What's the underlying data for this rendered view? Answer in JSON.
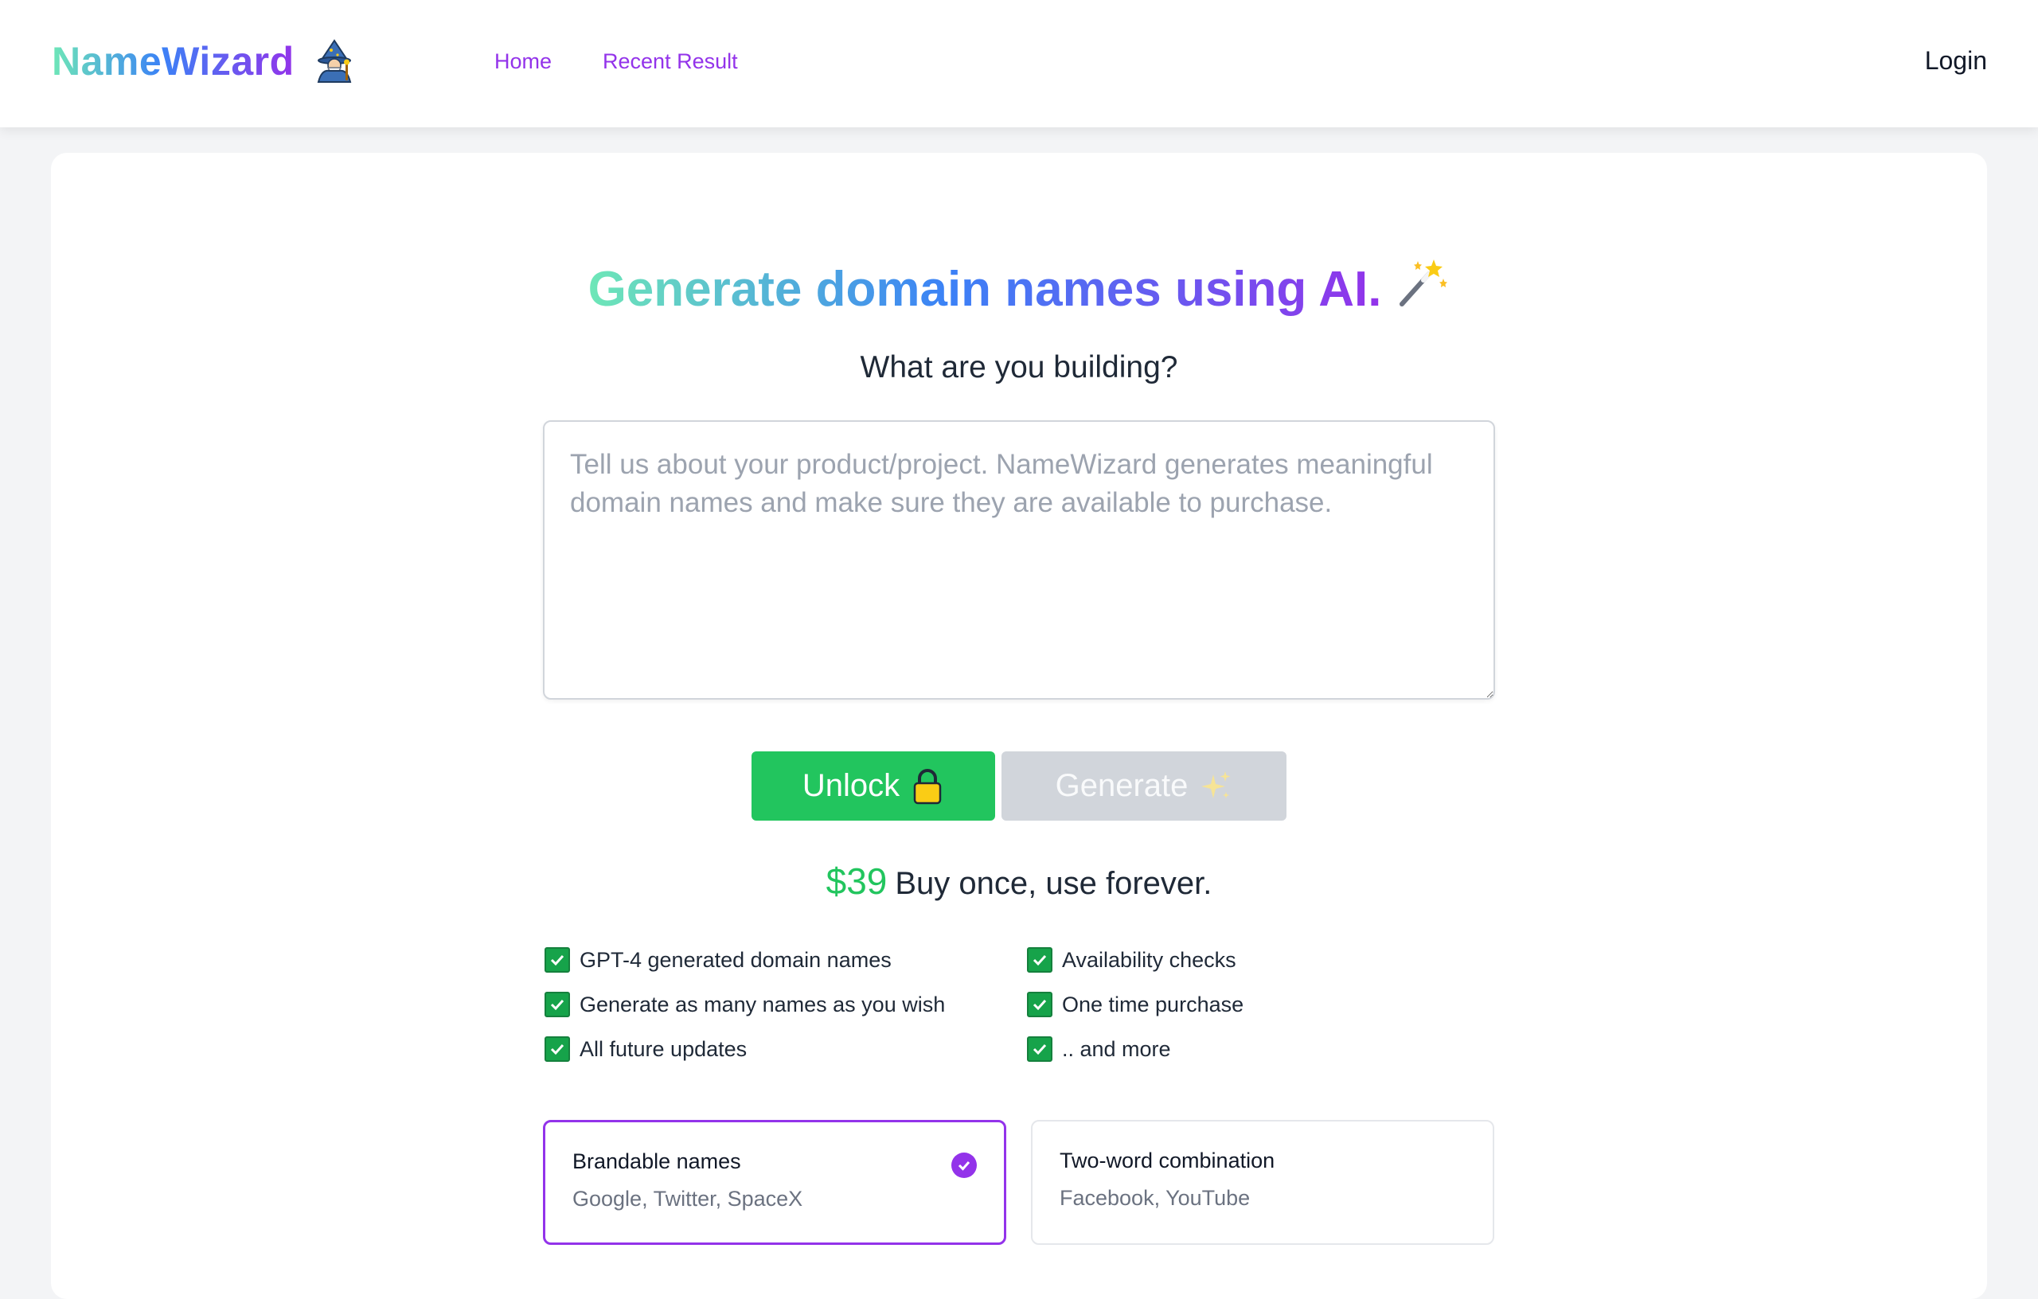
{
  "brand": {
    "name": "NameWizard",
    "icon": "wizard-icon"
  },
  "nav": {
    "links": [
      {
        "label": "Home"
      },
      {
        "label": "Recent Result"
      }
    ],
    "login_label": "Login"
  },
  "hero": {
    "headline": "Generate domain names using AI.",
    "headline_icon": "magic-wand-icon",
    "subheadline": "What are you building?"
  },
  "input": {
    "value": "",
    "placeholder": "Tell us about your product/project. NameWizard generates meaningful domain names and make sure they are available to purchase."
  },
  "actions": {
    "unlock_label": "Unlock",
    "unlock_icon": "lock-icon",
    "generate_label": "Generate",
    "generate_icon": "sparkles-icon"
  },
  "pricing": {
    "price": "$39",
    "tagline": "Buy once, use forever."
  },
  "features": [
    "GPT-4 generated domain names",
    "Availability checks",
    "Generate as many names as you wish",
    "One time purchase",
    "All future updates",
    ".. and more"
  ],
  "options": [
    {
      "title": "Brandable names",
      "examples": "Google, Twitter, SpaceX",
      "selected": true
    },
    {
      "title": "Two-word combination",
      "examples": "Facebook, YouTube",
      "selected": false
    }
  ],
  "colors": {
    "accent": "#9333ea",
    "success": "#22c55e",
    "disabled": "#d1d5db",
    "gradient_start": "#6ee7b7",
    "gradient_mid": "#3b82f6",
    "gradient_end": "#9333ea"
  }
}
